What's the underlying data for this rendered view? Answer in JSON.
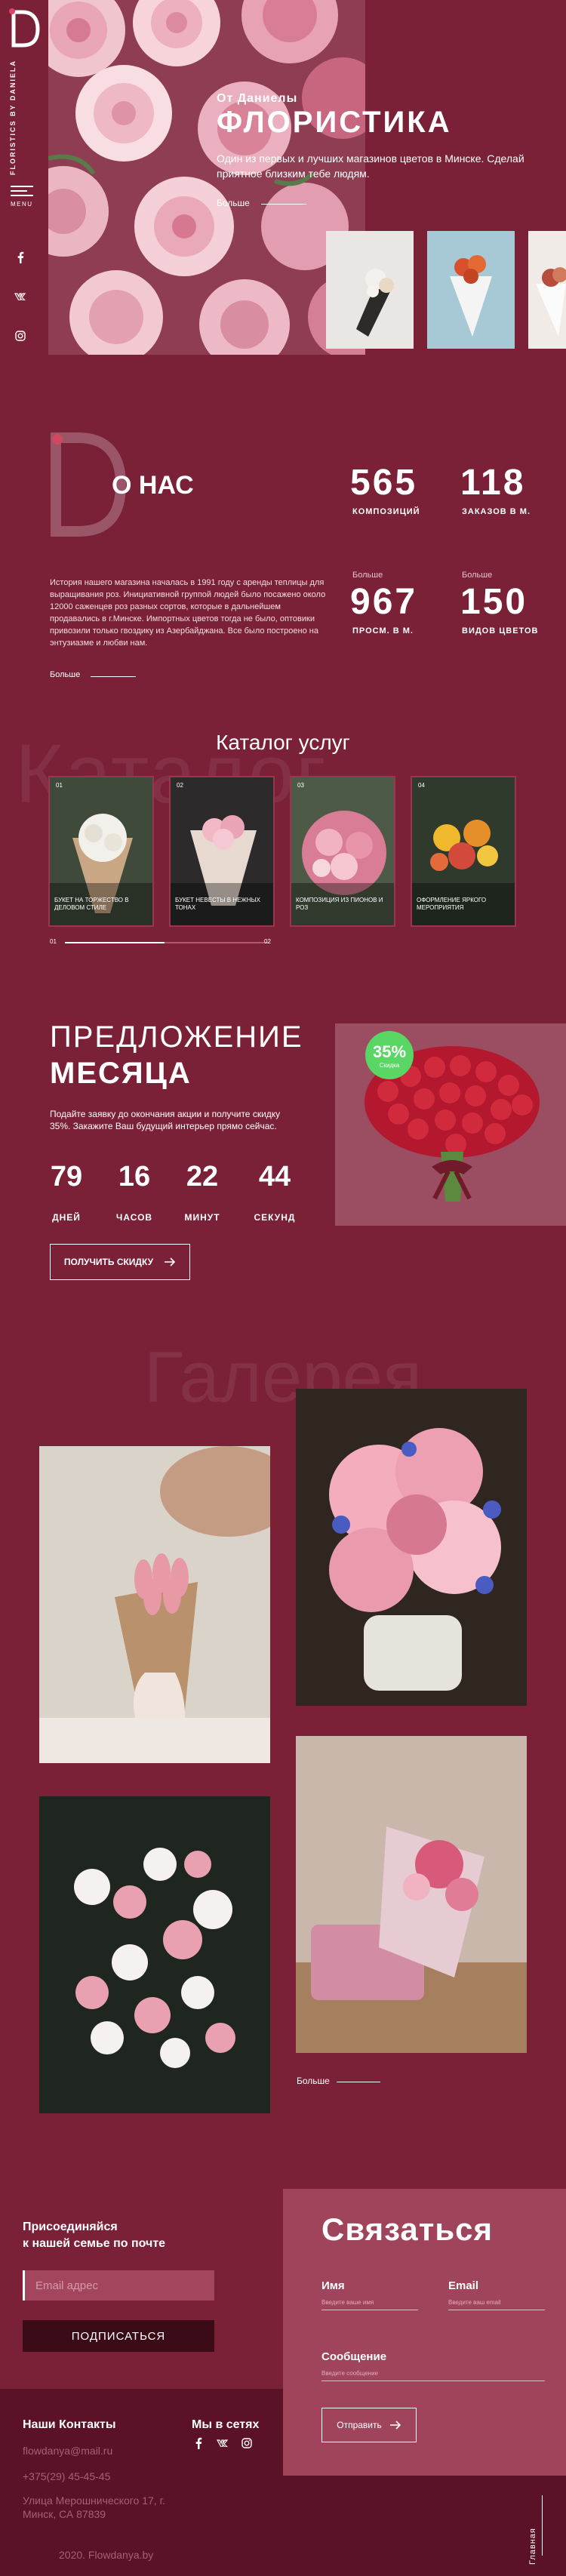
{
  "brand": {
    "vertical_title": "FLORISTICS BY DANIELA",
    "menu_label": "MENU"
  },
  "hero": {
    "subtitle": "От Даниелы",
    "title": "ФЛОРИСТИКА",
    "description": "Один из первых и лучших магазинов цветов в Минске. Сделай приятное близким тебе людям.",
    "more": "Больше"
  },
  "about": {
    "title": "О НАС",
    "stats": [
      {
        "pre": "",
        "value": "565",
        "label": "КОМПОЗИЦИЙ"
      },
      {
        "pre": "",
        "value": "118",
        "label": "ЗАКАЗОВ В М."
      },
      {
        "pre": "Больше",
        "value": "967",
        "label": "ПРОСМ. В М."
      },
      {
        "pre": "Больше",
        "value": "150",
        "label": "ВИДОВ ЦВЕТОВ"
      }
    ],
    "text": "История нашего магазина началась в 1991 году с аренды теплицы для выращивания роз. Инициативной группой людей было посажено около 12000 саженцев роз разных сортов, которые в дальнейшем продавались в г.Минске. Импортных цветов тогда не было, оптовики привозили только гвоздику из Азербайджана. Все было построено на энтузиазме и любви нам.",
    "more": "Больше"
  },
  "catalog": {
    "bg_word": "Каталог",
    "title": "Каталог услуг",
    "cards": [
      {
        "num": "01",
        "caption": "Букет на торжество в деловом стиле"
      },
      {
        "num": "02",
        "caption": "Букет невесты в нежных тонах"
      },
      {
        "num": "03",
        "caption": "Композиция из пионов и роз"
      },
      {
        "num": "04",
        "caption": "Оформление яркого мероприятия"
      }
    ],
    "page_start": "01",
    "page_end": "02"
  },
  "offer": {
    "title_line1": "ПРЕДЛОЖЕНИЕ",
    "title_line2": "МЕСЯЦА",
    "description": "Подайте заявку до окончания акции и получите скидку 35%. Закажите Ваш будущий интерьер прямо сейчас.",
    "countdown": [
      {
        "value": "79",
        "label": "ДНЕЙ"
      },
      {
        "value": "16",
        "label": "ЧАСОВ"
      },
      {
        "value": "22",
        "label": "МИНУТ"
      },
      {
        "value": "44",
        "label": "СЕКУНД"
      }
    ],
    "button": "ПОЛУЧИТЬ СКИДКУ",
    "badge_value": "35%",
    "badge_text": "Скидка"
  },
  "gallery": {
    "bg_word": "Галерея",
    "more": "Больше"
  },
  "newsletter": {
    "title": "Присоединяйся\nк нашей семье по почте",
    "placeholder": "Email адрес",
    "button": "ПОДПИСАТЬСЯ"
  },
  "contact_form": {
    "title": "Связаться",
    "name_label": "Имя",
    "name_placeholder": "Введите ваше имя",
    "email_label": "Email",
    "email_placeholder": "Введите ваш email",
    "message_label": "Сообщение",
    "message_placeholder": "Введите сообщение",
    "send": "Отправить"
  },
  "footer": {
    "contacts_title": "Наши Контакты",
    "email": "flowdanya@mail.ru",
    "phone": "+375(29) 45-45-45",
    "address": "Улица Мерошнического 17, г. Минск, СА 87839",
    "copyright": "2020. Flowdanya.by",
    "social_title": "Мы в сетях",
    "vertical_link": "Главная"
  },
  "colors": {
    "background": "#7a2037",
    "panel": "#a0445c",
    "footer": "#5b1226",
    "badge": "#59d664"
  }
}
